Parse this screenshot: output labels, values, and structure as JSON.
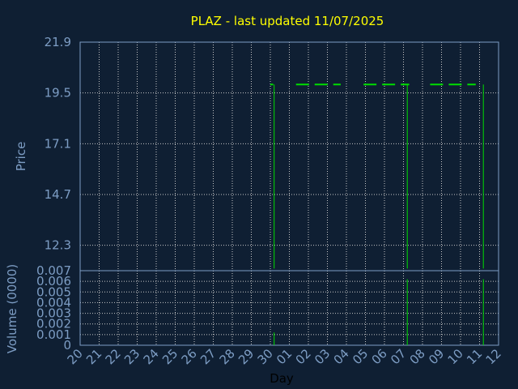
{
  "chart_data": {
    "title": "PLAZ - last updated 11/07/2025",
    "xlabel": "Day",
    "x_ticks": [
      "20",
      "21",
      "22",
      "23",
      "24",
      "25",
      "26",
      "27",
      "28",
      "29",
      "30",
      "01",
      "02",
      "03",
      "04",
      "05",
      "06",
      "07",
      "08",
      "09",
      "10",
      "11",
      "12"
    ],
    "price": {
      "type": "line",
      "ylabel": "Price",
      "ylim": [
        11.1,
        21.9
      ],
      "y_ticks": [
        "21.9",
        "19.5",
        "17.1",
        "14.7",
        "12.3"
      ],
      "y_tick_values": [
        21.9,
        19.5,
        17.1,
        14.7,
        12.3
      ],
      "grid": true,
      "close_level": 19.9,
      "close_segments": [
        [
          20,
          20.3
        ],
        [
          22.7,
          27.4
        ],
        [
          29.8,
          34.6
        ],
        [
          36.8,
          41.6
        ]
      ],
      "daily_ranges": [
        {
          "day_index": 10.2,
          "low": 11.2,
          "high": 19.9
        },
        {
          "day_index": 17.2,
          "low": 11.2,
          "high": 19.9
        },
        {
          "day_index": 21.2,
          "low": 11.2,
          "high": 19.9
        }
      ]
    },
    "volume": {
      "type": "bar",
      "ylabel": "Volume (0000)",
      "ylim": [
        0,
        0.007
      ],
      "y_ticks": [
        "0.007",
        "0.006",
        "0.005",
        "0.004",
        "0.003",
        "0.002",
        "0.001",
        "0"
      ],
      "y_tick_values": [
        0.007,
        0.006,
        0.005,
        0.004,
        0.003,
        0.002,
        0.001,
        0
      ],
      "grid": true,
      "bars": [
        {
          "day_index": 10.2,
          "value": 0.0012
        },
        {
          "day_index": 17.2,
          "value": 0.0062
        },
        {
          "day_index": 21.2,
          "value": 0.0062
        }
      ]
    },
    "colors": {
      "background": "#0f1f33",
      "title": "#ffff00",
      "axis_text": "#7d9dc4",
      "plot_border": "#7d9dc4",
      "grid": "#c8c8c8",
      "series": "#00dd00"
    }
  }
}
